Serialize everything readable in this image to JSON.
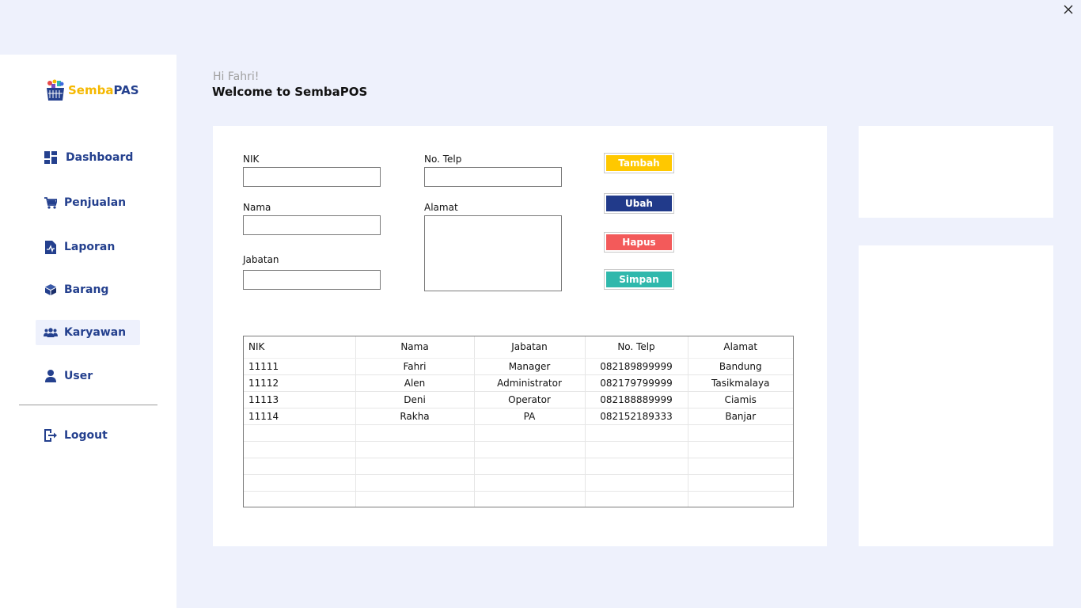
{
  "app": {
    "logo_part1": "Semba",
    "logo_part2": "PAS"
  },
  "sidebar": {
    "items": [
      {
        "label": "Dashboard",
        "icon": "dashboard-icon"
      },
      {
        "label": "Penjualan",
        "icon": "cart-icon"
      },
      {
        "label": "Laporan",
        "icon": "report-icon"
      },
      {
        "label": "Barang",
        "icon": "box-icon"
      },
      {
        "label": "Karyawan",
        "icon": "users-icon",
        "active": true
      },
      {
        "label": "User",
        "icon": "user-icon"
      }
    ],
    "logout_label": "Logout"
  },
  "header": {
    "greeting": "Hi Fahri!",
    "welcome": "Welcome to SembaPOS"
  },
  "form": {
    "nik_label": "NIK",
    "nik_value": "",
    "nama_label": "Nama",
    "nama_value": "",
    "jabatan_label": "Jabatan",
    "jabatan_value": "",
    "telp_label": "No. Telp",
    "telp_value": "",
    "alamat_label": "Alamat",
    "alamat_value": ""
  },
  "buttons": {
    "tambah": "Tambah",
    "ubah": "Ubah",
    "hapus": "Hapus",
    "simpan": "Simpan"
  },
  "colors": {
    "brand_blue": "#24408e",
    "brand_yellow": "#f5b800",
    "tambah": "#ffc800",
    "ubah": "#213a8a",
    "hapus": "#f35a5a",
    "simpan": "#2fb8ac"
  },
  "table": {
    "columns": [
      "NIK",
      "Nama",
      "Jabatan",
      "No. Telp",
      "Alamat"
    ],
    "rows": [
      [
        "11111",
        "Fahri",
        "Manager",
        "082189899999",
        "Bandung"
      ],
      [
        "11112",
        "Alen",
        "Administrator",
        "082179799999",
        "Tasikmalaya"
      ],
      [
        "11113",
        "Deni",
        "Operator",
        "082188889999",
        "Ciamis"
      ],
      [
        "11114",
        "Rakha",
        "PA",
        "082152189333",
        "Banjar"
      ],
      [
        "",
        "",
        "",
        "",
        ""
      ],
      [
        "",
        "",
        "",
        "",
        ""
      ],
      [
        "",
        "",
        "",
        "",
        ""
      ],
      [
        "",
        "",
        "",
        "",
        ""
      ],
      [
        "",
        "",
        "",
        "",
        ""
      ]
    ]
  }
}
